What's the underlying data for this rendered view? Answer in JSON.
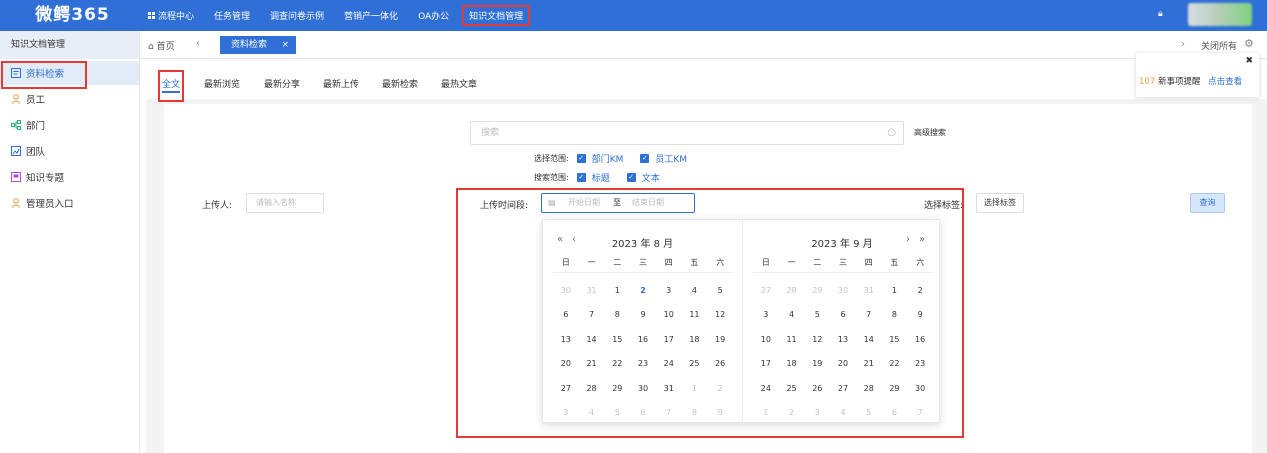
{
  "app": {
    "brand": "微鳄365"
  },
  "nav": {
    "workflow": "流程中心",
    "tasks": "任务管理",
    "survey": "调查问卷示例",
    "marketing": "营销产一体化",
    "oa": "OA办公",
    "knowledge": "知识文档管理"
  },
  "sidebar": {
    "title": "知识文档管理",
    "items": [
      {
        "label": "资料检索",
        "icon": "document-search-icon"
      },
      {
        "label": "员工",
        "icon": "user-icon"
      },
      {
        "label": "部门",
        "icon": "org-chart-icon"
      },
      {
        "label": "团队",
        "icon": "team-icon"
      },
      {
        "label": "知识专题",
        "icon": "topic-icon"
      },
      {
        "label": "管理员入口",
        "icon": "admin-icon"
      }
    ]
  },
  "tabbar": {
    "home": "首页",
    "current_tab": "资料检索",
    "close_all": "关闭所有"
  },
  "content_tabs": [
    "全文",
    "最新浏览",
    "最新分享",
    "最新上传",
    "最新检索",
    "最热文章"
  ],
  "search": {
    "placeholder": "搜索",
    "advanced": "高级搜索"
  },
  "scope": {
    "select_label": "选择范围:",
    "dept_km": "部门KM",
    "staff_km": "员工KM",
    "search_label": "搜索范围:",
    "title": "标题",
    "text": "文本"
  },
  "filters": {
    "uploader_label": "上传人:",
    "uploader_placeholder": "请输入名称",
    "period_label": "上传时间段:",
    "start_placeholder": "开始日期",
    "to": "至",
    "end_placeholder": "结束日期",
    "tag_label": "选择标签:",
    "tag_button": "选择标签",
    "query_button": "查询"
  },
  "calendar": {
    "left_title": "2023 年 8 月",
    "right_title": "2023 年 9 月",
    "weekdays": [
      "日",
      "一",
      "二",
      "三",
      "四",
      "五",
      "六"
    ],
    "left_days": [
      "30",
      "31",
      "1",
      "2",
      "3",
      "4",
      "5",
      "6",
      "7",
      "8",
      "9",
      "10",
      "11",
      "12",
      "13",
      "14",
      "15",
      "16",
      "17",
      "18",
      "19",
      "20",
      "21",
      "22",
      "23",
      "24",
      "25",
      "26",
      "27",
      "28",
      "29",
      "30",
      "31",
      "1",
      "2",
      "3",
      "4",
      "5",
      "6",
      "7",
      "8",
      "9"
    ],
    "left_other": [
      0,
      1,
      33,
      34,
      35,
      36,
      37,
      38,
      39,
      40,
      41
    ],
    "left_today": 3,
    "right_days": [
      "27",
      "28",
      "29",
      "30",
      "31",
      "1",
      "2",
      "3",
      "4",
      "5",
      "6",
      "7",
      "8",
      "9",
      "10",
      "11",
      "12",
      "13",
      "14",
      "15",
      "16",
      "17",
      "18",
      "19",
      "20",
      "21",
      "22",
      "23",
      "24",
      "25",
      "26",
      "27",
      "28",
      "29",
      "30",
      "1",
      "2",
      "3",
      "4",
      "5",
      "6",
      "7"
    ],
    "right_other": [
      0,
      1,
      2,
      3,
      4,
      35,
      36,
      37,
      38,
      39,
      40,
      41
    ]
  },
  "notice": {
    "count": "107",
    "text": "新事项提醒",
    "link": "点击查看"
  }
}
